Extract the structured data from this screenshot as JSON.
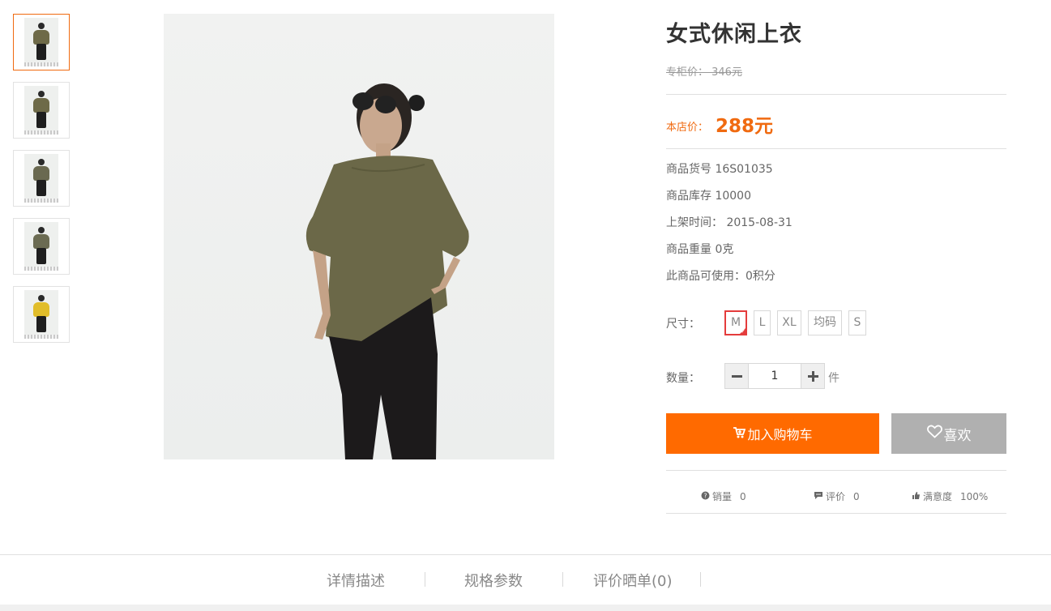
{
  "thumbnails": [
    {
      "name": "thumb-1",
      "top_color": "#6e6a48"
    },
    {
      "name": "thumb-2",
      "top_color": "#6e6a48"
    },
    {
      "name": "thumb-3",
      "top_color": "#6a6950"
    },
    {
      "name": "thumb-4",
      "top_color": "#6b6b52"
    },
    {
      "name": "thumb-5",
      "top_color": "#e1bd2a"
    }
  ],
  "product": {
    "title": "女式休闲上衣",
    "original_price": "专柜价： 346元",
    "shop_price_label": "本店价：",
    "shop_price": "288元",
    "sku": "商品货号 16S01035",
    "stock": "商品库存 10000",
    "listed": "上架时间： 2015-08-31",
    "weight": "商品重量 0克",
    "points": "此商品可使用：0积分"
  },
  "size": {
    "label": "尺寸：",
    "options": [
      "M",
      "L",
      "XL",
      "均码",
      "S"
    ],
    "selected": "M"
  },
  "quantity": {
    "label": "数量：",
    "value": "1",
    "unit": "件"
  },
  "actions": {
    "cart_label": "加入购物车",
    "like_label": "喜欢"
  },
  "stats": {
    "sales_label": "销量",
    "sales_value": "0",
    "reviews_label": "评价",
    "reviews_value": "0",
    "satisfaction_label": "满意度",
    "satisfaction_value": "100%"
  },
  "tabs": [
    "详情描述",
    "规格参数",
    "评价晒单(0)"
  ],
  "colors": {
    "accent": "#ff6a00",
    "price": "#f06a10",
    "selected_size": "#e43c3c",
    "like_button": "#b0b0b0",
    "garment": "#6b6848"
  }
}
